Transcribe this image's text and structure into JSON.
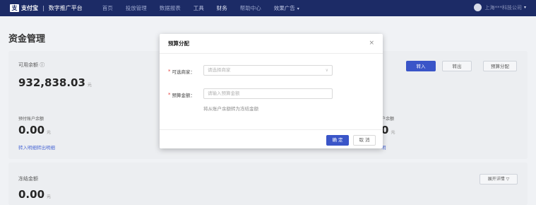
{
  "header": {
    "logo_text": "支",
    "brand": "支付宝",
    "separator": "|",
    "platform": "数字推广平台",
    "nav": [
      "首页",
      "投放管理",
      "数据报表",
      "工具",
      "财务",
      "帮助中心",
      "效果广告"
    ],
    "nav_more_caret": "▾",
    "user_name": "上海***科技公司",
    "user_caret": "▾"
  },
  "page": {
    "title": "资金管理"
  },
  "balance": {
    "available_label": "可用余额",
    "available_help": "ⓘ",
    "available_value": "932,838.03",
    "available_unit": "元",
    "btn_in": "转入",
    "btn_out": "转出",
    "btn_budget": "预算分配",
    "prepaid_label": "预付账户余额",
    "prepaid_value": "0.00",
    "prepaid_unit": "元",
    "link_in_detail": "转入明细",
    "link_out_detail": "转出明细",
    "right_label_peek": "户余额",
    "right_value_peek": "0",
    "right_unit_peek": "元",
    "right_link_peek": "明"
  },
  "frozen": {
    "label": "冻结金额",
    "value": "0.00",
    "unit": "元",
    "detail_btn": "展开详情 ▽"
  },
  "modal": {
    "title": "预算分配",
    "close": "×",
    "merchant_label": "可选商家：",
    "merchant_placeholder": "请选择商家",
    "merchant_arrow": "∨",
    "amount_label": "预算金额：",
    "amount_placeholder": "请输入预算金额",
    "amount_hint": "将从账户余额转为冻结金额",
    "required_mark": "*",
    "ok": "确 定",
    "cancel": "取 消"
  }
}
